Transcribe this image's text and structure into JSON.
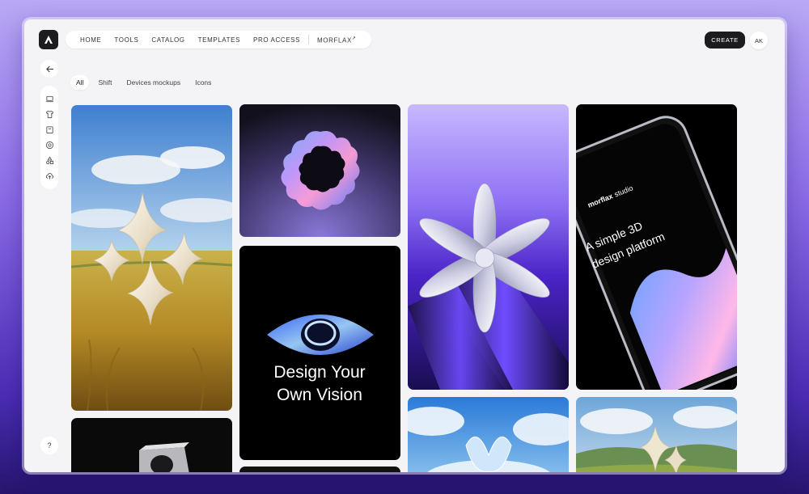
{
  "nav": {
    "items": [
      "HOME",
      "TOOLS",
      "CATALOG",
      "TEMPLATES",
      "PRO ACCESS"
    ],
    "external": "MORFLAX",
    "external_icon": "arrow-up-right-icon"
  },
  "header": {
    "create_label": "CREATE",
    "avatar_initials": "AK"
  },
  "sidebar": {
    "back_icon": "arrow-left-icon",
    "tools": [
      "laptop-icon",
      "tshirt-icon",
      "bag-icon",
      "badge-icon",
      "shapes-icon",
      "cloud-upload-icon"
    ],
    "help_label": "?"
  },
  "filters": {
    "tabs": [
      "All",
      "Shift",
      "Devices mockups",
      "Icons"
    ],
    "active": "All"
  },
  "gallery": {
    "cards": [
      {
        "id": "meadow-star",
        "subject": "3D star sculpture in wheat field"
      },
      {
        "id": "dark-cube",
        "subject": "chrome cube on black"
      },
      {
        "id": "chrome-gear",
        "subject": "iridescent chrome gear"
      },
      {
        "id": "eye-poster",
        "headline_1": "Design Your",
        "headline_2": "Own Vision"
      },
      {
        "id": "chrome-flower",
        "subject": "chrome flower on violet"
      },
      {
        "id": "phone-mockup",
        "brand": "morflax",
        "brand_suffix": "studio",
        "line_1": "A simple 3D",
        "line_2": "design platform"
      },
      {
        "id": "sky-shape",
        "subject": "glass shape in clouds"
      },
      {
        "id": "hills-star",
        "subject": "star sculpture over hills"
      }
    ]
  },
  "colors": {
    "accent_dark": "#1c1c1e",
    "violet": "#7a5cf0",
    "background": "#f4f4f6"
  }
}
